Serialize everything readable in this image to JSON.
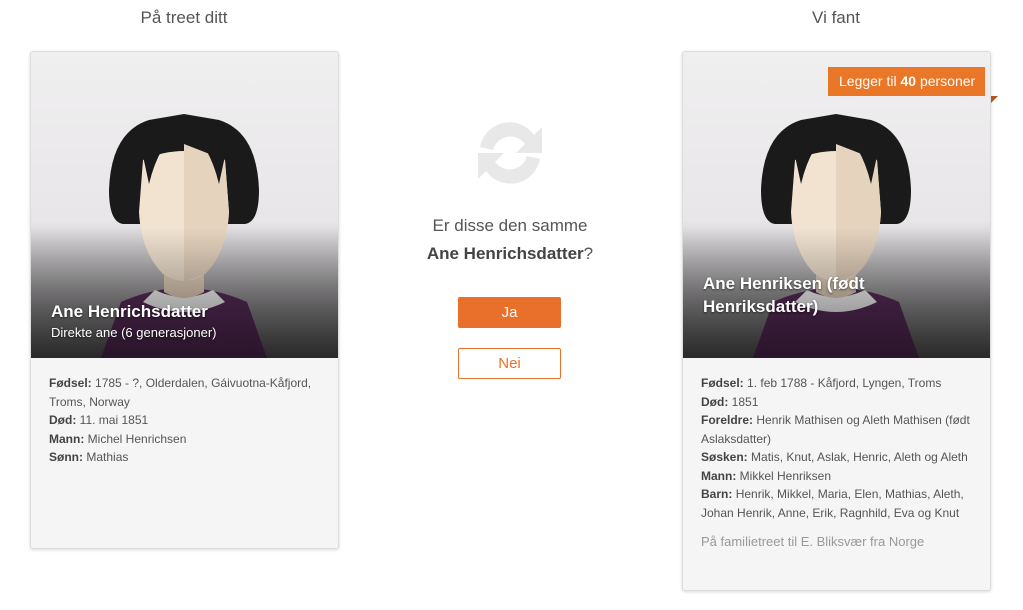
{
  "left": {
    "heading": "På treet ditt",
    "name": "Ane Henrichsdatter",
    "subtitle": "Direkte ane (6 generasjoner)",
    "facts": [
      {
        "label": "Fødsel:",
        "value": "1785 - ?, Olderdalen, Gáivuotna-Kåfjord, Troms, Norway"
      },
      {
        "label": "Død:",
        "value": "11. mai 1851"
      },
      {
        "label": "Mann:",
        "value": "Michel Henrichsen"
      },
      {
        "label": "Sønn:",
        "value": "Mathias"
      }
    ]
  },
  "center": {
    "icon": "sync-icon",
    "question_line1": "Er disse den samme",
    "question_name": "Ane Henrichsdatter",
    "question_mark": "?",
    "yes_label": "Ja",
    "no_label": "Nei"
  },
  "right": {
    "heading": "Vi fant",
    "badge_prefix": "Legger til ",
    "badge_count": "40",
    "badge_suffix": " personer",
    "name_line1": "Ane Henriksen (født",
    "name_line2": "Henriksdatter)",
    "facts": [
      {
        "label": "Fødsel:",
        "value": "1. feb 1788 - Kåfjord, Lyngen, Troms"
      },
      {
        "label": "Død:",
        "value": "1851"
      },
      {
        "label": "Foreldre:",
        "value": "Henrik Mathisen og Aleth Mathisen (født Aslaksdatter)"
      },
      {
        "label": "Søsken:",
        "value": "Matis, Knut, Aslak, Henric, Aleth og Aleth"
      },
      {
        "label": "Mann:",
        "value": "Mikkel Henriksen"
      },
      {
        "label": "Barn:",
        "value": "Henrik, Mikkel, Maria, Elen, Mathias, Aleth, Johan Henrik, Anne, Erik, Ragnhild, Eva og Knut"
      }
    ],
    "source": "På familietreet til E. Bliksvær fra Norge"
  },
  "colors": {
    "accent": "#e8702a",
    "dress": "#5b2d5c",
    "hair": "#1a1a1a",
    "skin": "#f1e3d0"
  }
}
